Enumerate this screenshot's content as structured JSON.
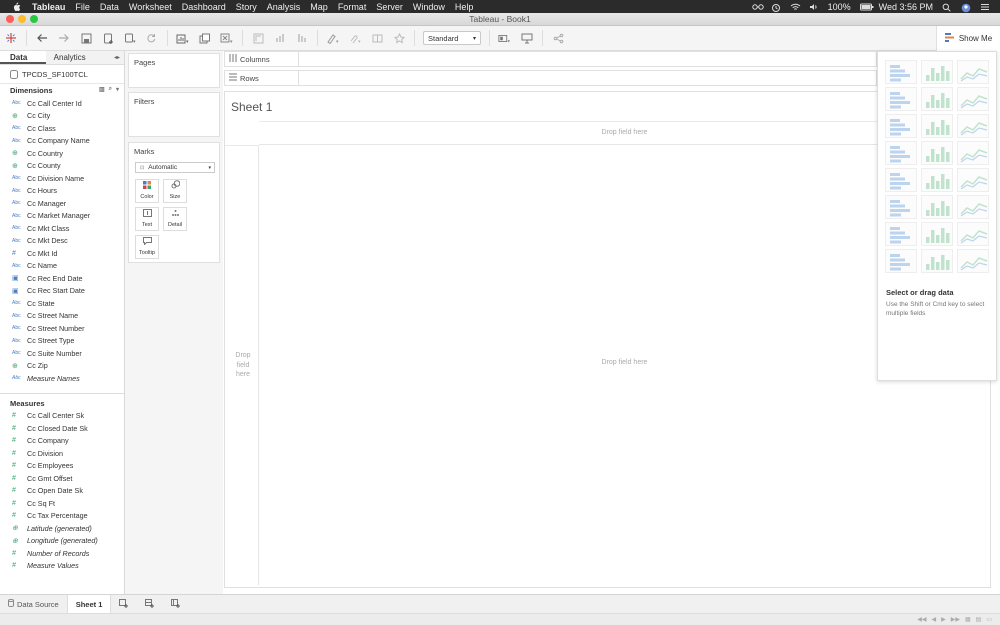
{
  "menubar": {
    "app": "Tableau",
    "items": [
      "File",
      "Data",
      "Worksheet",
      "Dashboard",
      "Story",
      "Analysis",
      "Map",
      "Format",
      "Server",
      "Window",
      "Help"
    ],
    "battery": "100%",
    "clock": "Wed 3:56 PM"
  },
  "window": {
    "title": "Tableau - Book1"
  },
  "toolbar": {
    "fit_select": "Standard",
    "show_me_label": "Show Me"
  },
  "data_pane": {
    "tabs": [
      "Data",
      "Analytics"
    ],
    "datasource": "TPCDS_SF100TCL",
    "dimensions_label": "Dimensions",
    "dimensions": [
      {
        "type": "Abc",
        "name": "Cc Call Center Id"
      },
      {
        "type": "geo",
        "name": "Cc City"
      },
      {
        "type": "Abc",
        "name": "Cc Class"
      },
      {
        "type": "Abc",
        "name": "Cc Company Name"
      },
      {
        "type": "geo",
        "name": "Cc Country"
      },
      {
        "type": "geo",
        "name": "Cc County"
      },
      {
        "type": "Abc",
        "name": "Cc Division Name"
      },
      {
        "type": "Abc",
        "name": "Cc Hours"
      },
      {
        "type": "Abc",
        "name": "Cc Manager"
      },
      {
        "type": "Abc",
        "name": "Cc Market Manager"
      },
      {
        "type": "Abc",
        "name": "Cc Mkt Class"
      },
      {
        "type": "Abc",
        "name": "Cc Mkt Desc"
      },
      {
        "type": "num",
        "name": "Cc Mkt Id"
      },
      {
        "type": "Abc",
        "name": "Cc Name"
      },
      {
        "type": "date",
        "name": "Cc Rec End Date"
      },
      {
        "type": "date",
        "name": "Cc Rec Start Date"
      },
      {
        "type": "Abc",
        "name": "Cc State"
      },
      {
        "type": "Abc",
        "name": "Cc Street Name"
      },
      {
        "type": "Abc",
        "name": "Cc Street Number"
      },
      {
        "type": "Abc",
        "name": "Cc Street Type"
      },
      {
        "type": "Abc",
        "name": "Cc Suite Number"
      },
      {
        "type": "geo",
        "name": "Cc Zip"
      },
      {
        "type": "Abc",
        "name": "Measure Names"
      }
    ],
    "measures_label": "Measures",
    "measures": [
      {
        "name": "Cc Call Center Sk"
      },
      {
        "name": "Cc Closed Date Sk"
      },
      {
        "name": "Cc Company"
      },
      {
        "name": "Cc Division"
      },
      {
        "name": "Cc Employees"
      },
      {
        "name": "Cc Gmt Offset"
      },
      {
        "name": "Cc Open Date Sk"
      },
      {
        "name": "Cc Sq Ft"
      },
      {
        "name": "Cc Tax Percentage"
      },
      {
        "name": "Latitude (generated)"
      },
      {
        "name": "Longitude (generated)"
      },
      {
        "name": "Number of Records"
      },
      {
        "name": "Measure Values"
      }
    ]
  },
  "cards": {
    "pages": "Pages",
    "filters": "Filters",
    "marks": "Marks",
    "marks_type": "Automatic",
    "mark_buttons": [
      "Color",
      "Size",
      "Text",
      "Detail",
      "Tooltip"
    ]
  },
  "shelves": {
    "columns": "Columns",
    "rows": "Rows"
  },
  "view": {
    "sheet_title": "Sheet 1",
    "drop_top": "Drop field here",
    "drop_left": "Drop field here",
    "drop_center": "Drop field here"
  },
  "show_me": {
    "help_title": "Select or drag data",
    "help_text": "Use the Shift or Cmd key to select multiple fields"
  },
  "bottom": {
    "data_source_tab": "Data Source",
    "sheet_tab": "Sheet 1"
  },
  "colors": {
    "accent_blue": "#4a7ec3",
    "accent_green": "#3aa36f",
    "menubar": "#2b2b2b"
  }
}
